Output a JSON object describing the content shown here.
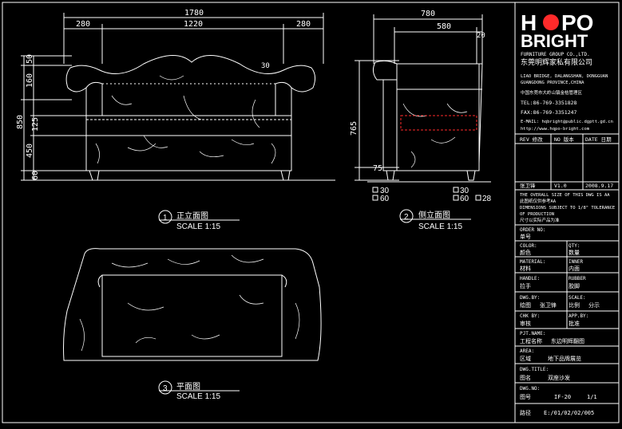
{
  "logo": {
    "line1a": "H",
    "line1b": "PO",
    "line2": "BRIGHT",
    "tagline": "FURNITURE GROUP CO.,LTD.",
    "cn_name": "东莞明辉家私有限公司"
  },
  "company": {
    "lines": [
      "LIAO BRIDGE, DALANGSHAN, DONGGUAN",
      "GUANGDONG PROVINCE,CHINA",
      "中国东莞市大岭山镇金桔管理区"
    ],
    "tel": "TEL:86-769-3351828",
    "fax": "FAX:86-769-3351247",
    "email": "E-MAIL: hqbright@public.dgptt.gd.cn",
    "web": "http://www.hqpo-bright.com"
  },
  "revision": {
    "rev": "REV 修改",
    "no": "NO 版本",
    "date": "DATE 日期"
  },
  "version": {
    "name": "张卫锋",
    "ver": "V1.0",
    "date": "2008.9.17"
  },
  "notes": [
    "THE OVERALL SIZE OF THIS DWG IS AA",
    "此图纸仅供参考AA",
    "DIMENSIONS SUBJECT TO 1/8\" TOLERANCE",
    "OF PRODUCTION",
    "尺寸以实际产品为准"
  ],
  "title_block": [
    {
      "label": "ORDER NO:",
      "value": "单号",
      "value2": ""
    },
    {
      "label": "COLOR:",
      "value": "颜色",
      "label2": "QTY:",
      "value2": "数量"
    },
    {
      "label": "MATERIAL:",
      "value": "材料",
      "label2": "INNER",
      "value2": "内面"
    },
    {
      "label": "HANDLE:",
      "value": "拉手",
      "label2": "RUBBER",
      "value2": "胶脚"
    },
    {
      "label": "DWG.BY:",
      "value": "绘图",
      "label2": "SCALE:",
      "value2": "比例"
    },
    {
      "label": "CHK BY:",
      "value": "审核",
      "label2": "APP.BY:",
      "value2": "批准"
    },
    {
      "label": "PJT.NAME:",
      "value": "工程名称",
      "value2": ""
    },
    {
      "label": "AREA:",
      "value": "区域",
      "value2": ""
    },
    {
      "label": "DWG.TITLE:",
      "value": "图名",
      "value2": ""
    },
    {
      "label": "DWG.NO:",
      "value": "图号",
      "value2": ""
    },
    {
      "label": "",
      "value": "路径",
      "value2": ""
    }
  ],
  "title_values": {
    "dwg_by": "张卫锋",
    "scale_l": "比例",
    "scale_v": "分示",
    "chk_by": "审核",
    "app_by": "批准",
    "project": "东边明辉翻图",
    "area": "地下品牌展览",
    "dwg_title": "双座沙发",
    "dwg_no": "IF-20",
    "sheet": "1/1",
    "path": "E:/01/02/02/005"
  },
  "views": {
    "front": {
      "num": "1",
      "title": "正立面图",
      "scale": "SCALE 1:15"
    },
    "side": {
      "num": "2",
      "title": "侧立面图",
      "scale": "SCALE 1:15"
    },
    "plan": {
      "num": "3",
      "title": "平面图",
      "scale": "SCALE 1:15"
    }
  },
  "dims": {
    "front_top": "1780",
    "front_sub": [
      "280",
      "1220",
      "280"
    ],
    "front_left": [
      "50",
      "160",
      "850",
      "125",
      "450",
      "60"
    ],
    "front_back": "30",
    "side_top": "780",
    "side_sub": [
      "580",
      "20"
    ],
    "side_left": "765",
    "side_75": "75",
    "leg_a": [
      "30",
      "60"
    ],
    "leg_b": [
      "28",
      "30",
      "60"
    ]
  },
  "colors": {
    "line": "#ffffff",
    "accent": "#ff2a2a",
    "text": "#ffffff",
    "bg": "#000000"
  }
}
